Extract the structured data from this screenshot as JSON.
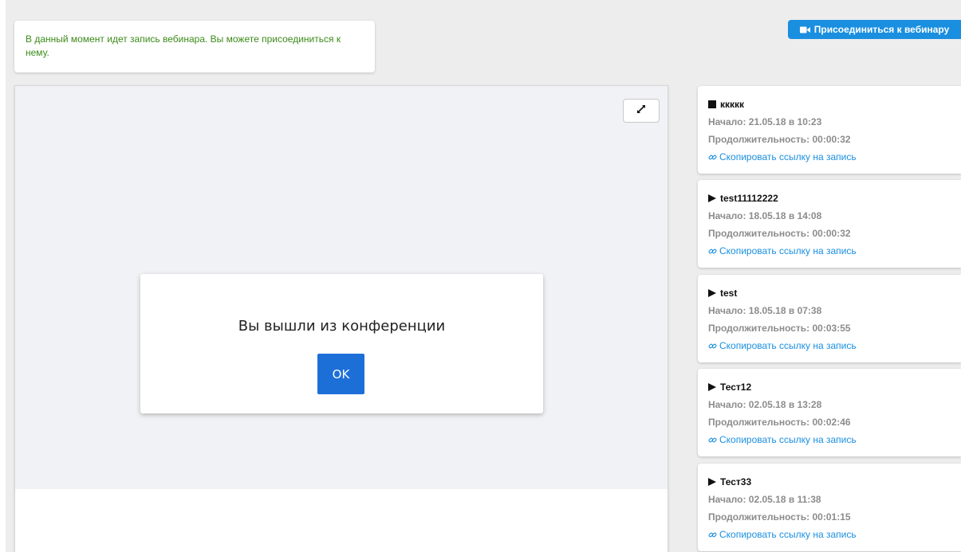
{
  "notice": {
    "text": "В данный момент идет запись вебинара. Вы можете присоединиться к нему."
  },
  "header": {
    "join_label": "Присоединиться к вебинару",
    "join_icon": "video-camera-icon"
  },
  "player": {
    "fullscreen_icon": "expand-icon"
  },
  "dialog": {
    "message": "Вы вышли из конференции",
    "ok_label": "OK"
  },
  "recordings": [
    {
      "icon": "stop-icon",
      "title": "ккккк",
      "start": "Начало: 21.05.18 в 10:23",
      "duration": "Продолжительность: 00:00:32",
      "link": "Скопировать ссылку на запись"
    },
    {
      "icon": "play-icon",
      "title": "test11112222",
      "start": "Начало: 18.05.18 в 14:08",
      "duration": "Продолжительность: 00:00:32",
      "link": "Скопировать ссылку на запись"
    },
    {
      "icon": "play-icon",
      "title": "test",
      "start": "Начало: 18.05.18 в 07:38",
      "duration": "Продолжительность: 00:03:55",
      "link": "Скопировать ссылку на запись"
    },
    {
      "icon": "play-icon",
      "title": "Тест12",
      "start": "Начало: 02.05.18 в 13:28",
      "duration": "Продолжительность: 00:02:46",
      "link": "Скопировать ссылку на запись"
    },
    {
      "icon": "play-icon",
      "title": "Тест33",
      "start": "Начало: 02.05.18 в 11:38",
      "duration": "Продолжительность: 00:01:15",
      "link": "Скопировать ссылку на запись"
    }
  ],
  "colors": {
    "accent": "#1a8fe0",
    "ok_button": "#1d6fd8",
    "notice_text": "#3c8b1a",
    "muted_text": "#8c8c8c"
  }
}
